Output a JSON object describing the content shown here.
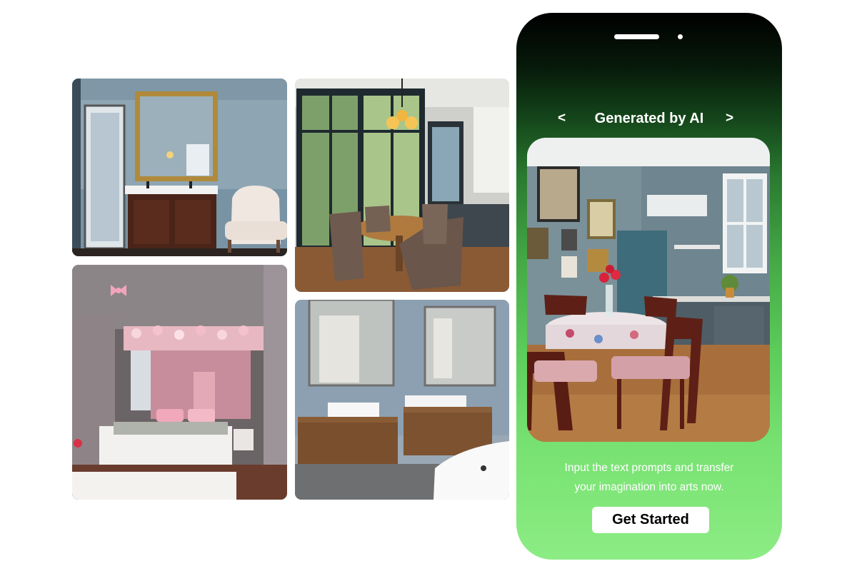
{
  "gallery": {
    "images": [
      {
        "name": "bathroom-vanity-photo"
      },
      {
        "name": "dining-room-photo"
      },
      {
        "name": "pink-bedroom-photo"
      },
      {
        "name": "modern-bathroom-photo"
      }
    ]
  },
  "phone": {
    "carousel": {
      "prev_label": "<",
      "title": "Generated by AI",
      "next_label": ">"
    },
    "hero_image": "ai-generated-kitchen-dining-photo",
    "description_line1": "Input the text prompts and transfer",
    "description_line2": "your imagination into arts now.",
    "cta_label": "Get Started"
  },
  "colors": {
    "phone_gradient_top": "#000000",
    "phone_gradient_bottom": "#8cec84",
    "cta_background": "#ffffff",
    "text_light": "#ffffff"
  }
}
